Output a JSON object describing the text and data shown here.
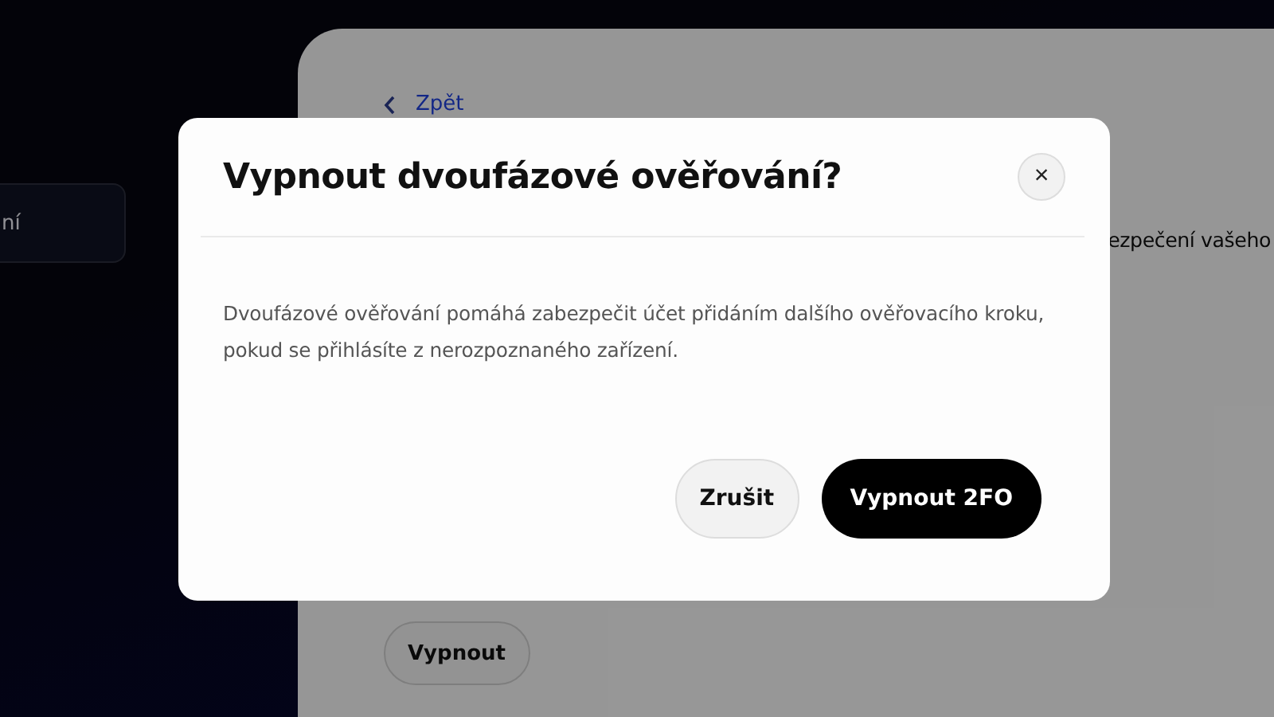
{
  "sidebar": {
    "items": [
      {
        "label": "ní",
        "selected": true
      }
    ]
  },
  "page": {
    "back_link": "Zpět",
    "description_fragment": "ezpečení vašeho",
    "disable_button": "Vypnout"
  },
  "dialog": {
    "title": "Vypnout dvoufázové ověřování?",
    "close_icon": "×",
    "message": "Dvoufázové ověřování pomáhá zabezpečit účet přidáním dalšího ověřovacího kroku, pokud se přihlásíte z nerozpoznaného zařízení.",
    "buttons": [
      {
        "label": "Zrušit",
        "kind": "secondary"
      },
      {
        "label": "Vypnout 2FO",
        "kind": "primary"
      }
    ]
  }
}
